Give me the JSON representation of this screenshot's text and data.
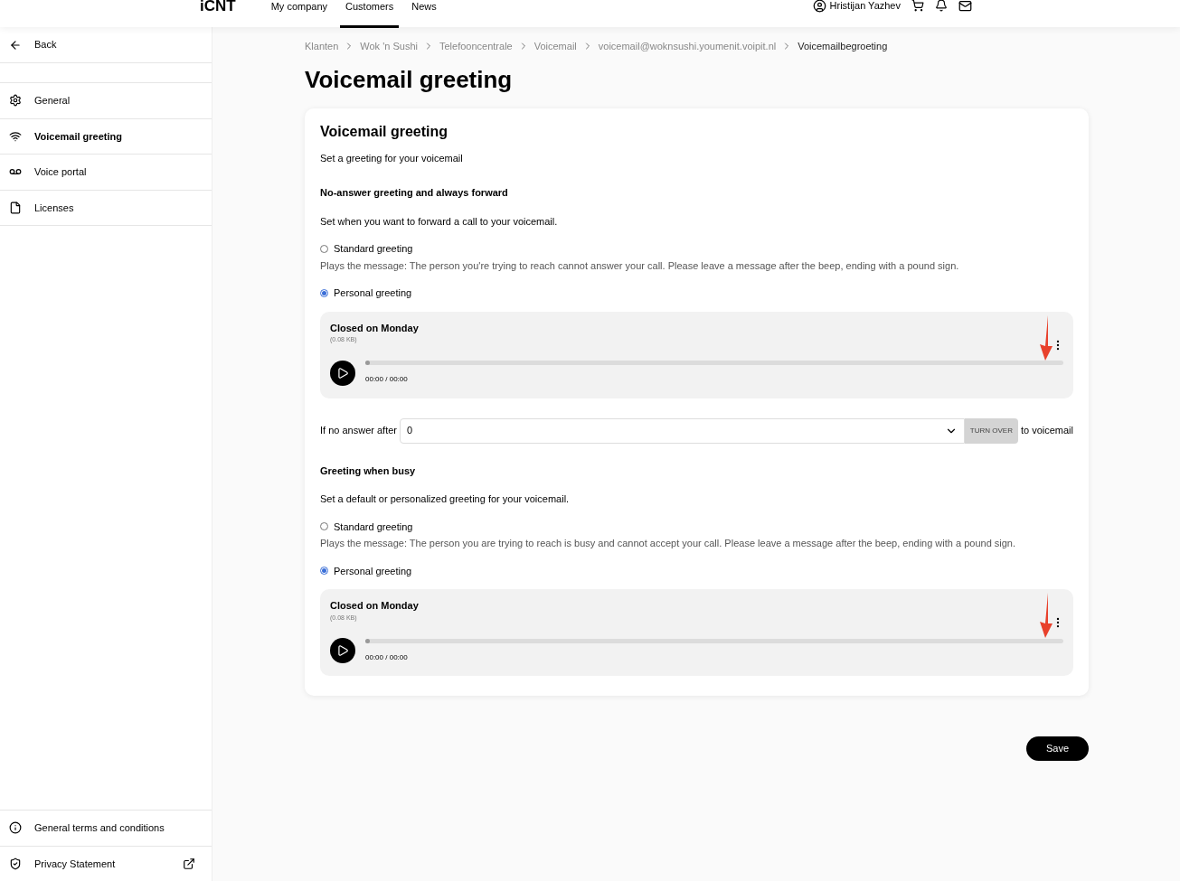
{
  "topbar": {
    "logo": "iCNT",
    "nav": [
      {
        "label": "My company",
        "selected": false
      },
      {
        "label": "Customers",
        "selected": true
      },
      {
        "label": "News",
        "selected": false
      }
    ],
    "user": "Hristijan Yazhev"
  },
  "sidebar": {
    "back": "Back",
    "items": [
      {
        "label": "General",
        "selected": false
      },
      {
        "label": "Voicemail greeting",
        "selected": true
      },
      {
        "label": "Voice portal",
        "selected": false
      },
      {
        "label": "Licenses",
        "selected": false
      }
    ],
    "footer": [
      {
        "label": "General terms and conditions",
        "external": false
      },
      {
        "label": "Privacy Statement",
        "external": true
      }
    ]
  },
  "breadcrumbs": [
    "Klanten",
    "Wok 'n Sushi",
    "Telefooncentrale",
    "Voicemail",
    "voicemail@woknsushi.youmenit.voipit.nl",
    "Voicemailbegroeting"
  ],
  "title": "Voicemail greeting",
  "card": {
    "title": "Voicemail greeting",
    "subtitle": "Set a greeting for your voicemail",
    "sections": [
      {
        "heading": "No-answer greeting and always forward",
        "description": "Set when you want to forward a call to your voicemail.",
        "options": [
          {
            "label": "Standard greeting",
            "selected": false,
            "note": "Plays the message: The person you're trying to reach cannot answer your call. Please leave a message after the beep, ending with a pound sign."
          },
          {
            "label": "Personal greeting",
            "selected": true
          }
        ],
        "player": {
          "name": "Closed on Monday",
          "size": "(0.08 KB)",
          "time": "00:00 / 00:00",
          "level": 0
        },
        "forward": {
          "label": "If no answer after",
          "value": "0",
          "button": "TURN OVER",
          "suffix": "to voicemail"
        }
      },
      {
        "heading": "Greeting when busy",
        "description": "Set a default or personalized greeting for your voicemail.",
        "options": [
          {
            "label": "Standard greeting",
            "selected": false,
            "note": "Plays the message: The person you are trying to reach is busy and cannot accept your call. Please leave a message after the beep, ending with a pound sign."
          },
          {
            "label": "Personal greeting",
            "selected": true
          }
        ],
        "player": {
          "name": "Closed on Monday",
          "size": "(0.08 KB)",
          "time": "00:00 / 00:00",
          "level": 0
        }
      }
    ]
  },
  "save": "Save"
}
